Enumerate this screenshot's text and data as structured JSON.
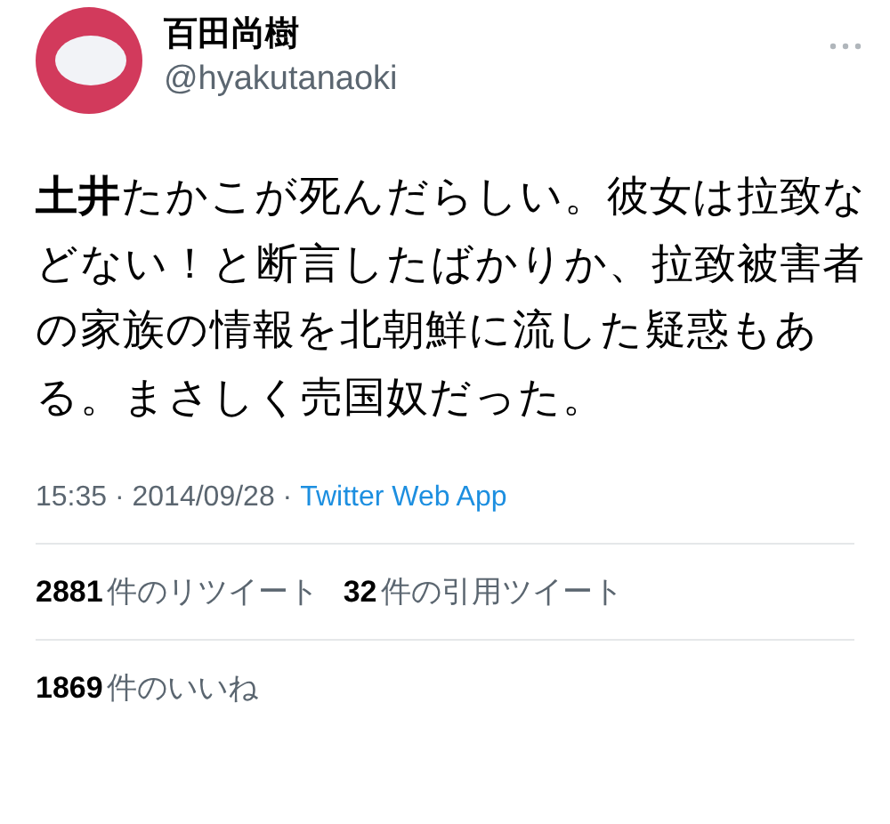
{
  "author": {
    "name": "百田尚樹",
    "handle": "@hyakutanaoki"
  },
  "tweet": {
    "text": "**土井**たかこが死んだらしい。彼女は拉致などない！と断言したばかりか、拉致被害者の家族の情報を北朝鮮に流した疑惑もある。まさしく売国奴だった。"
  },
  "meta": {
    "time": "15:35 · 2014/09/28 · ",
    "source": "Twitter Web App"
  },
  "stats": [
    {
      "count": "2881",
      "label": "件のリツイート"
    },
    {
      "count": "32",
      "label": "件の引用ツイート"
    },
    {
      "count": "1869",
      "label": "件のいいね"
    }
  ]
}
